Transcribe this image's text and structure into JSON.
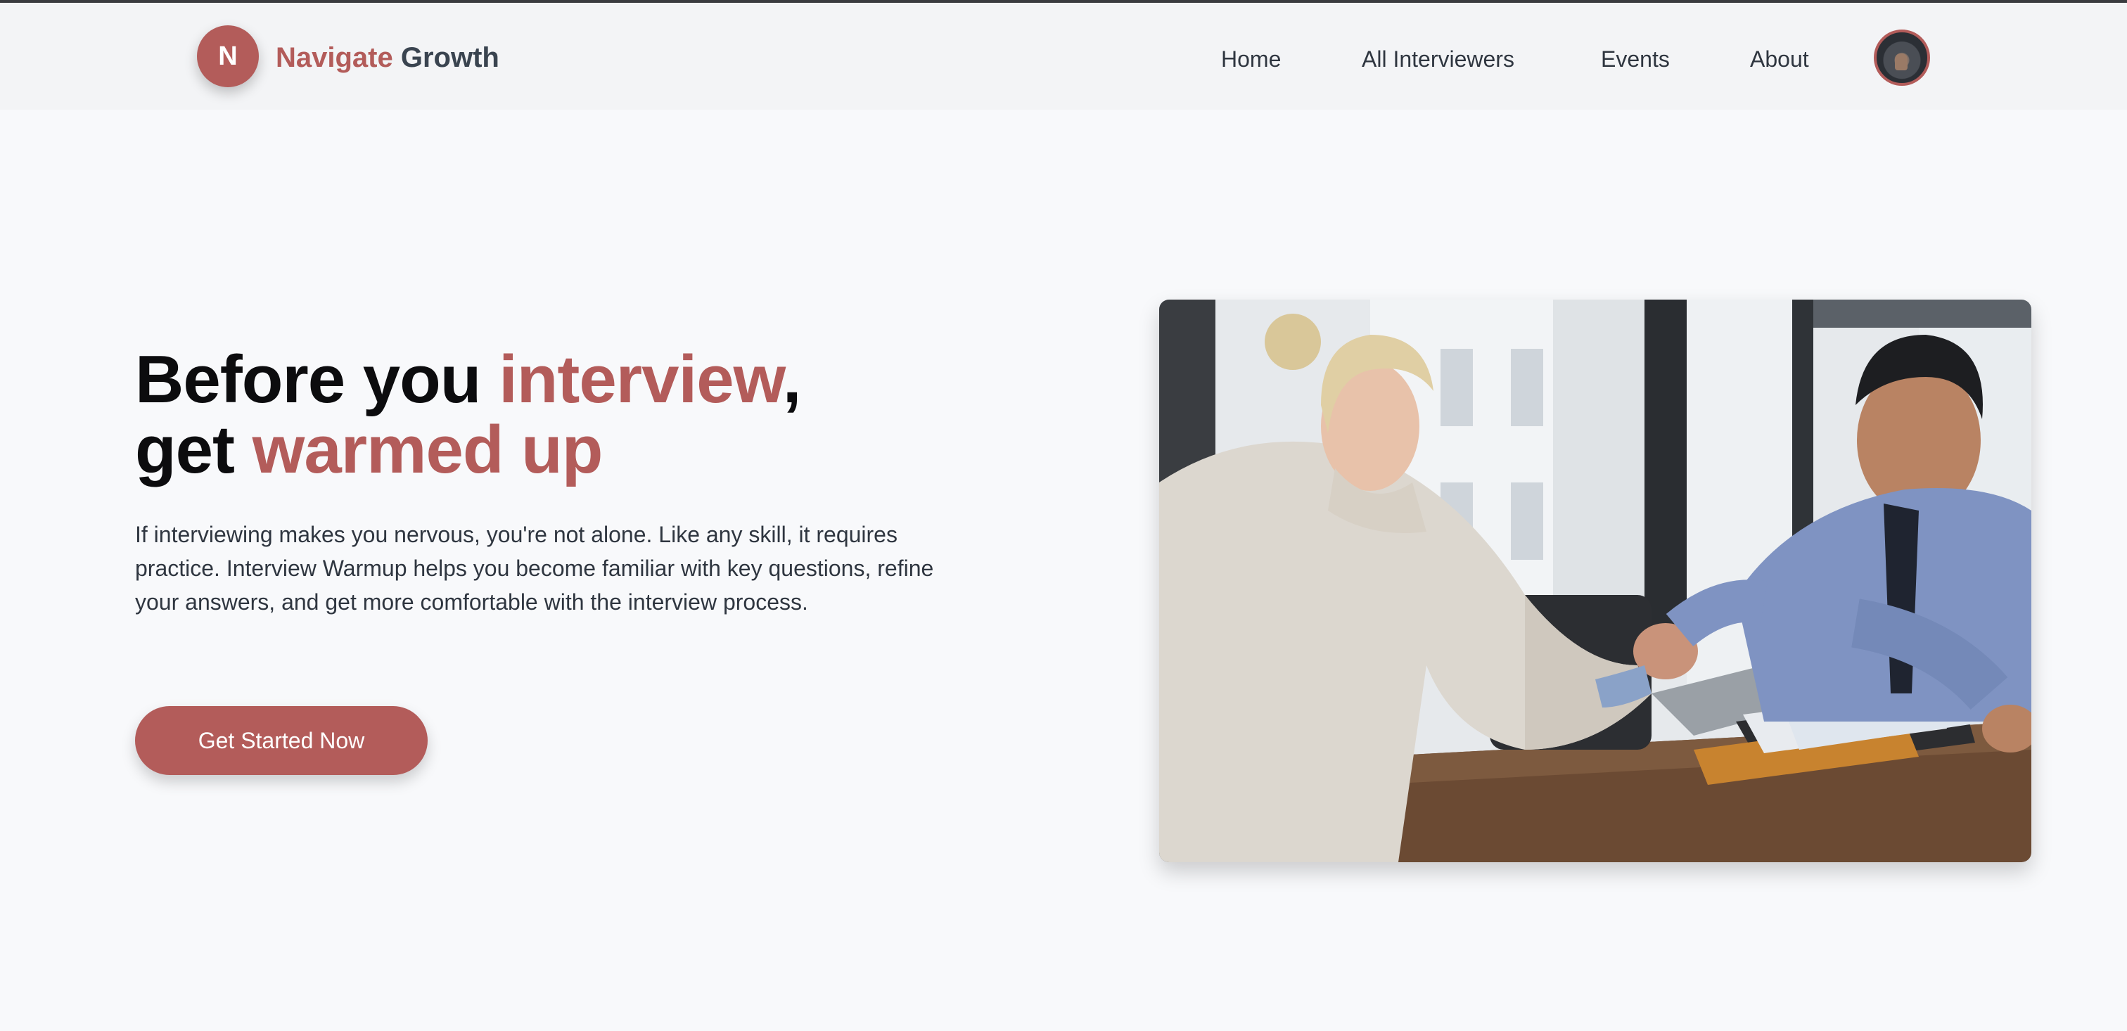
{
  "brand": {
    "logo_letter": "N",
    "name_part1": "Navigate",
    "name_part2": "Growth",
    "accent_color": "#b35c5a"
  },
  "nav": {
    "items": [
      {
        "label": "Home"
      },
      {
        "label": "All Interviewers"
      },
      {
        "label": "Events"
      },
      {
        "label": "About"
      }
    ],
    "avatar_icon": "user-avatar-icon"
  },
  "hero": {
    "title_part1": "Before you ",
    "title_accent1": "interview",
    "title_part2": ",",
    "title_part3": "get ",
    "title_accent2": "warmed up",
    "description": "If interviewing makes you nervous, you're not alone. Like any skill, it requires practice. Interview Warmup helps you become familiar with key questions, refine your answers, and get more comfortable with the interview process.",
    "cta_label": "Get Started Now"
  }
}
